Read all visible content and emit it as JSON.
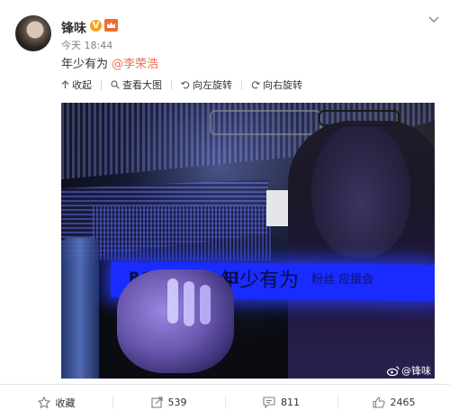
{
  "post": {
    "username": "锋味",
    "verified_badge": "V",
    "time": "今天 18:44",
    "text": "年少有为 ",
    "mention": "@李荣浩"
  },
  "media_toolbar": {
    "collapse": "收起",
    "view_large": "查看大图",
    "rotate_left": "向左旋转",
    "rotate_right": "向右旋转"
  },
  "photo": {
    "banner_latin": "RONGHAO LI",
    "banner_cn": "年少有为",
    "banner_small": "粉丝 应援会",
    "watermark": "@锋味"
  },
  "actions": {
    "favorite": "收藏",
    "repost_count": "539",
    "comment_count": "811",
    "like_count": "2465"
  },
  "colors": {
    "mention": "#eb7350",
    "badge": "#f7a21b",
    "banner": "#1a2bff"
  }
}
